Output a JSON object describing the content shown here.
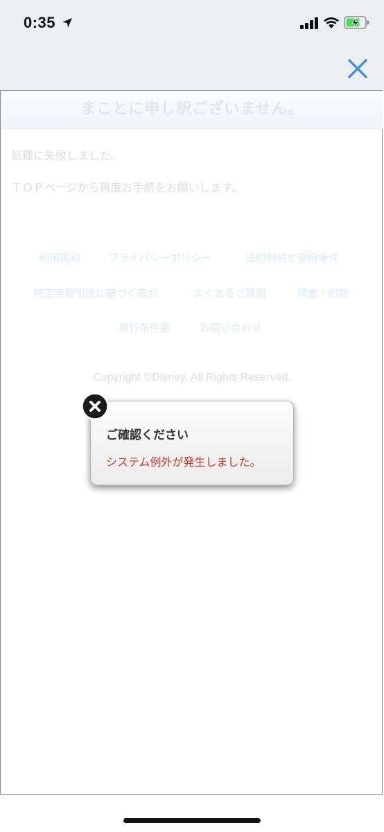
{
  "status_bar": {
    "time": "0:35",
    "icons": [
      "location-arrow-icon",
      "cellular-signal-icon",
      "wifi-icon",
      "battery-charging-icon"
    ]
  },
  "nav": {
    "close_icon": "close-icon"
  },
  "page": {
    "heading": "まことに申し訳ございません。",
    "error_message": "処理に失敗しました。",
    "instruction": "ＴＯＰページから再度お手続をお願いします。",
    "footer_links": [
      "利用規約",
      "プライバシーポリシー",
      "法的制約と使用条件",
      "特定商取引法に基づく表記",
      "よくあるご質問",
      "標識・約款",
      "旅行条件書",
      "お問い合わせ"
    ],
    "copyright": "Copyright ©Disney. All Rights Reserved."
  },
  "dialog": {
    "title": "ご確認ください",
    "message": "システム例外が発生しました。"
  },
  "colors": {
    "accent": "#4a90d9",
    "error_text": "#c0392b"
  }
}
